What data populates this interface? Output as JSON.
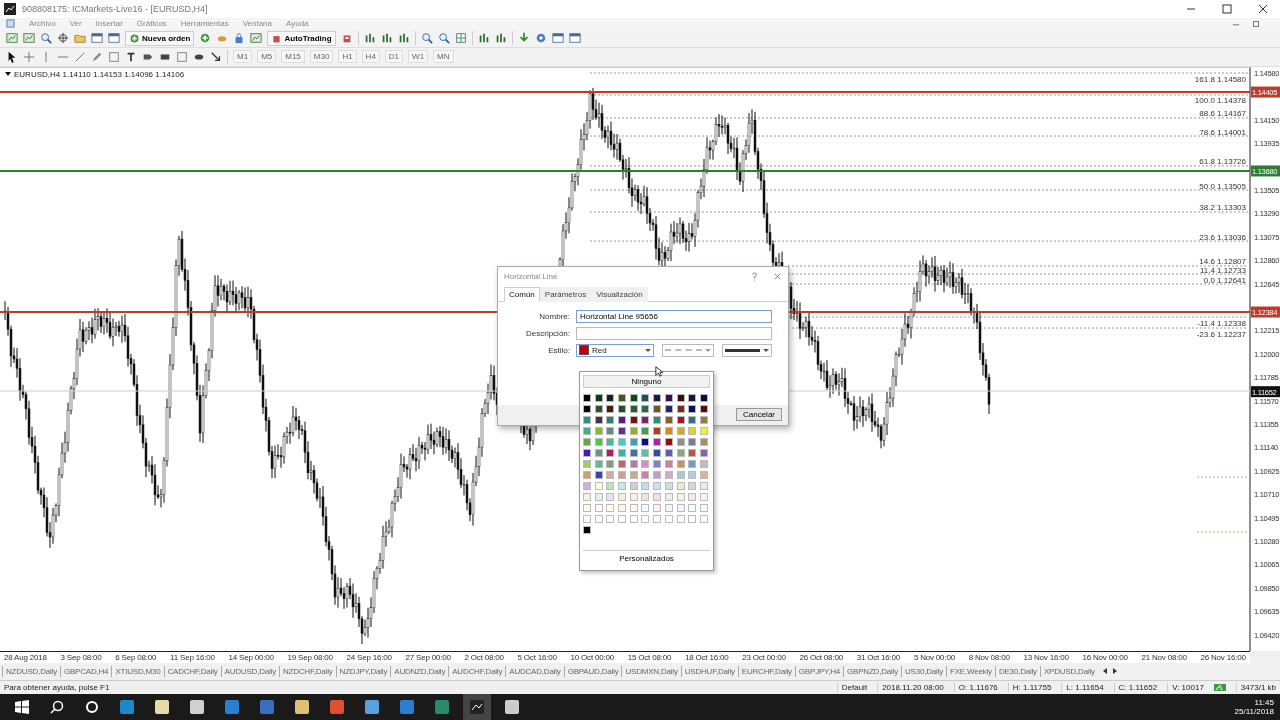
{
  "window": {
    "title": "908808175: ICMarkets-Live16 - [EURUSD,H4]"
  },
  "menu": [
    "Archivo",
    "Ver",
    "Insertar",
    "Gráficos",
    "Herramientas",
    "Ventana",
    "Ayuda"
  ],
  "toolbar": {
    "new_order": "Nueva orden",
    "autotrading": "AutoTrading"
  },
  "timeframes": [
    "M1",
    "M5",
    "M15",
    "M30",
    "H1",
    "H4",
    "D1",
    "W1",
    "MN"
  ],
  "chart": {
    "header": "EURUSD,H4  1.14110 1.14153 1.14096 1.14106",
    "price_ticks": [
      "1.14580",
      "1.14150",
      "1.13935",
      "1.13505",
      "1.13290",
      "1.13075",
      "1.12860",
      "1.12645",
      "1.12215",
      "1.12000",
      "1.11785",
      "1.11570",
      "1.11355",
      "1.11140",
      "1.10925",
      "1.10710",
      "1.10495",
      "1.10280",
      "1.10065",
      "1.09850",
      "1.09635",
      "1.09420"
    ],
    "fibo_levels": [
      {
        "ratio": "161.8",
        "price": "1.14580"
      },
      {
        "ratio": "100.0",
        "price": "1.14378"
      },
      {
        "ratio": "88.6",
        "price": "1.14167"
      },
      {
        "ratio": "78.6",
        "price": "1.14001"
      },
      {
        "ratio": "61.8",
        "price": "1.13726"
      },
      {
        "ratio": "50.0",
        "price": "1.13505"
      },
      {
        "ratio": "38.2",
        "price": "1.13303"
      },
      {
        "ratio": "23.6",
        "price": "1.13036"
      },
      {
        "ratio": "14.6",
        "price": "1.12807"
      },
      {
        "ratio": "11.4",
        "price": "1.12733"
      },
      {
        "ratio": "0.0",
        "price": "1.12641"
      },
      {
        "ratio": "-11.4",
        "price": "1.12338"
      },
      {
        "ratio": "-23.6",
        "price": "1.12237"
      }
    ],
    "lines": [
      {
        "price": "1.14405",
        "color": "#c0392b"
      },
      {
        "price": "1.13680",
        "color": "#2e7d32"
      },
      {
        "price": "1.12384",
        "color": "#c0392b"
      }
    ],
    "close_tag": "1.11652",
    "dates": [
      "28 Aug 2018",
      "3 Sep 08:00",
      "6 Sep 08:00",
      "11 Sep 16:00",
      "14 Sep 00:00",
      "19 Sep 08:00",
      "24 Sep 16:00",
      "27 Sep 00:00",
      "2 Oct 08:00",
      "5 Oct 16:00",
      "10 Oct 00:00",
      "15 Oct 08:00",
      "18 Oct 16:00",
      "23 Oct 00:00",
      "26 Oct 08:00",
      "31 Oct 16:00",
      "5 Nov 00:00",
      "8 Nov 08:00",
      "13 Nov 16:00",
      "16 Nov 00:00",
      "21 Nov 08:00",
      "26 Nov 16:00"
    ]
  },
  "dialog": {
    "title": "Horizontal Line",
    "tabs": [
      {
        "label": "Común",
        "selected": true
      },
      {
        "label": "Parámetros",
        "selected": false
      },
      {
        "label": "Visualización",
        "selected": false
      }
    ],
    "name_label": "Nombre:",
    "name_value": "Horizontal Line 95656",
    "description_label": "Descripción:",
    "style_label": "Estilo:",
    "color_name": "Red",
    "color": "#c00000",
    "cancel": "Cancelar"
  },
  "palette": {
    "none_label": "Ninguno",
    "custom_label": "Personalizados",
    "rows": [
      {
        "swatches": [
          {
            "color": "#000000"
          },
          {
            "color": "#0b3d0b"
          },
          {
            "color": "#0f2a1a"
          },
          {
            "color": "#4b5320"
          },
          {
            "color": "#0b4a0b"
          },
          {
            "color": "#1f4f4f"
          },
          {
            "color": "#1a1a4a"
          },
          {
            "color": "#3b0f4f"
          },
          {
            "color": "#3a0a0a"
          },
          {
            "color": "#14143c"
          },
          {
            "color": "#0a0a3a"
          }
        ]
      },
      {
        "swatches": [
          {
            "color": "#000000"
          },
          {
            "color": "#2f4f2f"
          },
          {
            "color": "#4a1a0a"
          },
          {
            "color": "#1f4f2f"
          },
          {
            "color": "#2e5a2e"
          },
          {
            "color": "#2a6a4a"
          },
          {
            "color": "#6a5a2a"
          },
          {
            "color": "#1a2a6a"
          },
          {
            "color": "#7a2a1a"
          },
          {
            "color": "#0a0a6a"
          },
          {
            "color": "#5a0a0a"
          }
        ]
      },
      {
        "swatches": [
          {
            "color": "#2f8f8f"
          },
          {
            "color": "#3a3a3a"
          },
          {
            "color": "#2f7f6f"
          },
          {
            "color": "#5a1a8a"
          },
          {
            "color": "#8a0a0a"
          },
          {
            "color": "#8a1a6a"
          },
          {
            "color": "#2f8f6f"
          },
          {
            "color": "#8f5a2f"
          },
          {
            "color": "#9a1a2a"
          },
          {
            "color": "#2f6f8f"
          },
          {
            "color": "#8f7f3f"
          }
        ]
      },
      {
        "swatches": [
          {
            "color": "#3faf8f"
          },
          {
            "color": "#7fbf2f"
          },
          {
            "color": "#5f8f7f"
          },
          {
            "color": "#6a2a9a"
          },
          {
            "color": "#8faf2f"
          },
          {
            "color": "#3f9f4f"
          },
          {
            "color": "#af3f1f"
          },
          {
            "color": "#cf8f1f"
          },
          {
            "color": "#cfaf1f"
          },
          {
            "color": "#dfcf3f"
          },
          {
            "color": "#efef3f"
          }
        ]
      },
      {
        "swatches": [
          {
            "color": "#5faf3f"
          },
          {
            "color": "#3fcf3f"
          },
          {
            "color": "#3fbf8f"
          },
          {
            "color": "#3fcfcf"
          },
          {
            "color": "#3f9fbf"
          },
          {
            "color": "#0a0a9a"
          },
          {
            "color": "#af1faf"
          },
          {
            "color": "#9f0a0a"
          },
          {
            "color": "#8f8f8f"
          },
          {
            "color": "#6f7f9f"
          },
          {
            "color": "#af8f5f"
          }
        ]
      },
      {
        "swatches": [
          {
            "color": "#4a1aaf"
          },
          {
            "color": "#6f8f8f"
          },
          {
            "color": "#af1f5f"
          },
          {
            "color": "#3fafaf"
          },
          {
            "color": "#3f6faf"
          },
          {
            "color": "#5fbf9f"
          },
          {
            "color": "#2f4faf"
          },
          {
            "color": "#5f5faf"
          },
          {
            "color": "#7faf7f"
          },
          {
            "color": "#af5f3f"
          },
          {
            "color": "#8f5faf"
          }
        ]
      },
      {
        "swatches": [
          {
            "color": "#9fcf5f"
          },
          {
            "color": "#5fbf8f"
          },
          {
            "color": "#7f9f7f"
          },
          {
            "color": "#cf5f5f"
          },
          {
            "color": "#af7f9f"
          },
          {
            "color": "#cf8fcf"
          },
          {
            "color": "#7f7fcf"
          },
          {
            "color": "#cf7f9f"
          },
          {
            "color": "#cf8f5f"
          },
          {
            "color": "#6f9fcf"
          },
          {
            "color": "#bfbfbf"
          }
        ]
      },
      {
        "swatches": [
          {
            "color": "#cf9f6f"
          },
          {
            "color": "#3f3faf"
          },
          {
            "color": "#cfaf9f"
          },
          {
            "color": "#cf9f8f"
          },
          {
            "color": "#bfaf8f"
          },
          {
            "color": "#cf7f9f"
          },
          {
            "color": "#bf9fcf"
          },
          {
            "color": "#cfafbf"
          },
          {
            "color": "#9fcfcf"
          },
          {
            "color": "#afcfdf"
          },
          {
            "color": "#dfaf9f"
          }
        ]
      },
      {
        "swatches": [
          {
            "color": "#cfafdf"
          },
          {
            "color": "#ffffcf"
          },
          {
            "color": "#bfdfbf"
          },
          {
            "color": "#bfefdf"
          },
          {
            "color": "#cfcfcf"
          },
          {
            "color": "#bfdfef"
          },
          {
            "color": "#cfdfef"
          },
          {
            "color": "#cfdfdf"
          },
          {
            "color": "#dfefcf"
          },
          {
            "color": "#dfcfdf"
          },
          {
            "color": "#dfefef"
          }
        ]
      },
      {
        "swatches": [
          {
            "color": "#f5f0e0"
          },
          {
            "color": "#dff5f5"
          },
          {
            "color": "#efe0ef"
          },
          {
            "color": "#f5eedd"
          },
          {
            "color": "#f5f5dd"
          },
          {
            "color": "#f0e6d0"
          },
          {
            "color": "#f5e0e5"
          },
          {
            "color": "#e6eef5"
          },
          {
            "color": "#f5f0e0"
          },
          {
            "color": "#f5e6ef"
          },
          {
            "color": "#f8f4e8"
          }
        ]
      },
      {
        "swatches": [
          {
            "color": "#fffaf0"
          },
          {
            "color": "#fffaf5"
          },
          {
            "color": "#fffff0"
          },
          {
            "color": "#fff5ee"
          },
          {
            "color": "#fafaf0"
          },
          {
            "color": "#f8f8ff"
          },
          {
            "color": "#fff0f5"
          },
          {
            "color": "#f5f5f5"
          },
          {
            "color": "#f0f8ff"
          },
          {
            "color": "#f0fff0"
          },
          {
            "color": "#fff5fa"
          }
        ]
      },
      {
        "swatches": [
          {
            "color": "#ffffff"
          },
          {
            "color": "#ffffff"
          },
          {
            "color": "#ffffff"
          },
          {
            "color": "#ffffff"
          },
          {
            "color": "#ffffff"
          },
          {
            "color": "#ffffff"
          },
          {
            "color": "#ffffff"
          },
          {
            "color": "#ffffff"
          },
          {
            "color": "#ffffff"
          },
          {
            "color": "#ffffff"
          },
          {
            "color": "#ffffff"
          }
        ]
      },
      {
        "swatches": [
          {
            "color": "#000000"
          }
        ]
      }
    ]
  },
  "symbol_tabs": [
    "NZDUSD,Daily",
    "GBPCAD,H4",
    "XTIUSD,M30",
    "CADCHF,Daily",
    "AUDUSD,Daily",
    "NZDCHF,Daily",
    "NZDJPY,Daily",
    "AUDNZD,Daily",
    "AUDCHF,Daily",
    "AUDCAD,Daily",
    "GBPAUD,Daily",
    "USDMXN,Daily",
    "USDHUF,Daily",
    "EURCHF,Daily",
    "GBPJPY,H4",
    "GBPNZD,Daily",
    "US30,Daily",
    "FXE,Weekly",
    "DE30,Daily",
    "XPDUSD,Daily"
  ],
  "status_bar": {
    "help": "Para obtener ayuda, pulse F1",
    "profile": "Default",
    "time": "2018.11.20 08:00",
    "open": "O: 1.11676",
    "high": "H: 1.11755",
    "low": "L: 1.11654",
    "close": "C: 1.11652",
    "volume": "V: 10017",
    "traffic": "3473/1 kb"
  },
  "taskbar": {
    "time": "11:45",
    "date": "25/11/2018"
  }
}
